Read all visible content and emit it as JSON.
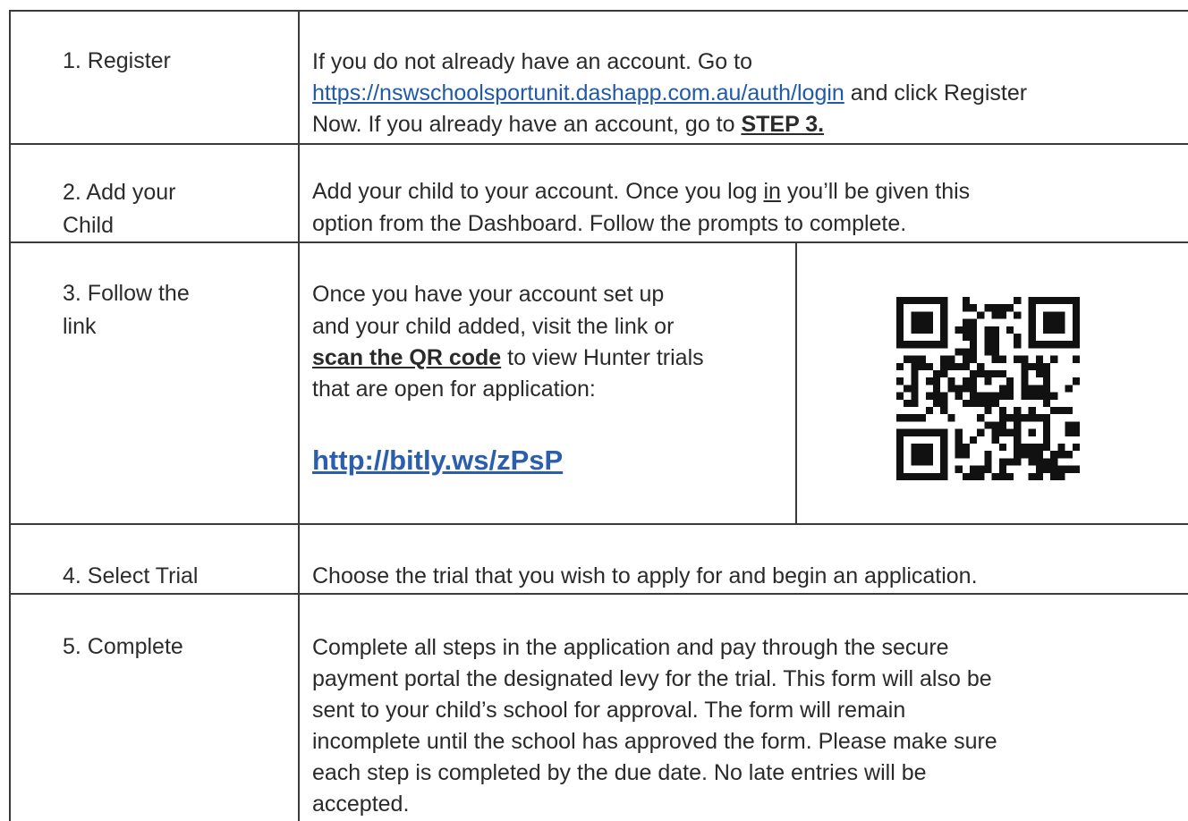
{
  "steps": [
    {
      "label": "1. Register",
      "line1": "If you do not already have an account. Go to",
      "url": "https://nswschoolsportunit.dashapp.com.au/auth/login",
      "after_url": " and click Register",
      "line3_pre": "Now.  If you already have an account, go to ",
      "step_ref": "STEP 3."
    },
    {
      "label_line1": "2. Add your",
      "label_line2": "Child",
      "line1_pre": "Add your child to your account.  Once you log ",
      "login_word": "in",
      "line1_post": " you’ll be given this",
      "line2": "option from the Dashboard.  Follow the prompts to complete."
    },
    {
      "label_line1": "3. Follow the",
      "label_line2": "link",
      "line1": "Once you have your account set up",
      "line2": "and your child added, visit the link or",
      "qr_phrase": "scan the QR code",
      "line3_post": " to view Hunter trials",
      "line4": "that are open for application:",
      "short_url": "http://bitly.ws/zPsP",
      "qr_icon": "qr-code-icon"
    },
    {
      "label": "4. Select Trial",
      "text": "Choose the trial that you wish to apply for and begin an application."
    },
    {
      "label": "5. Complete",
      "lines": [
        "Complete all steps in the application and pay through the secure",
        "payment portal the designated levy for the trial.  This form will also be",
        "sent to your child’s school for approval.  The form will remain",
        "incomplete until the school has approved the form. Please make sure",
        "each step is completed by the due date. No late entries will be",
        "accepted."
      ]
    }
  ]
}
